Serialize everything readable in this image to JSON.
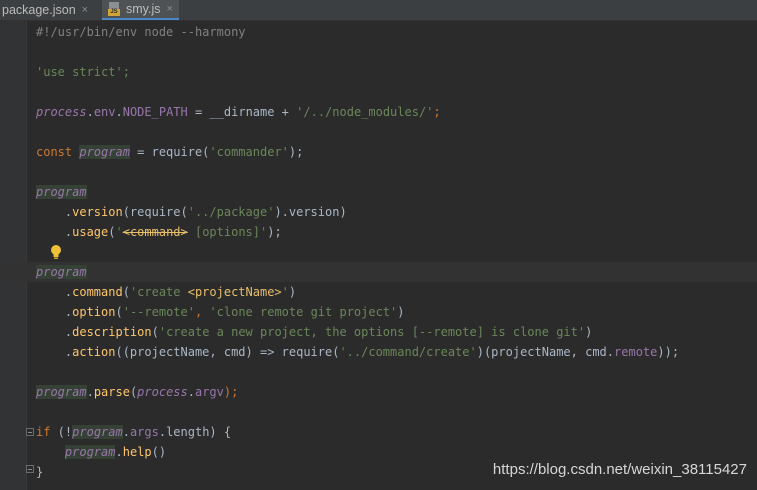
{
  "tabs": [
    {
      "label": "package.json",
      "active": false,
      "close": "×"
    },
    {
      "label": "smy.js",
      "active": true,
      "close": "×",
      "icon": "js-file-icon"
    }
  ],
  "code": {
    "l1": "#!/usr/bin/env node --harmony",
    "l3": "'use strict';",
    "l5": [
      "process",
      ".",
      "env",
      ".",
      "NODE_PATH",
      " = __dirname + ",
      "'/../node_modules/'",
      ";"
    ],
    "l7": [
      "const",
      " ",
      "program",
      " = require(",
      "'commander'",
      ");"
    ],
    "l9": "program",
    "l10": [
      "    .",
      "version",
      "(require(",
      "'../package'",
      ").version)"
    ],
    "l11": [
      "    .",
      "usage",
      "(",
      "'",
      "<command>",
      " [options]",
      "'",
      ");"
    ],
    "l13": "program",
    "l14": [
      "    .",
      "command",
      "(",
      "'create ",
      "<projectName>",
      "'",
      ")"
    ],
    "l15": [
      "    .",
      "option",
      "(",
      "'--remote'",
      ", ",
      "'clone remote git project'",
      ")"
    ],
    "l16": [
      "    .",
      "description",
      "(",
      "'create a new project, the options [--remote] is clone git'",
      ")"
    ],
    "l17": [
      "    .",
      "action",
      "((projectName, cmd) => require(",
      "'../command/create'",
      ")(projectName, cmd.",
      "remote",
      "));"
    ],
    "l19": [
      "program",
      ".",
      "parse",
      "(",
      "process",
      ".",
      "argv",
      ");"
    ],
    "l21": [
      "if",
      " (!",
      "program",
      ".",
      "args",
      ".length) {"
    ],
    "l22": [
      "    ",
      "program",
      ".",
      "help",
      "()"
    ],
    "l23": "}"
  },
  "watermark": "https://blog.csdn.net/weixin_38115427"
}
